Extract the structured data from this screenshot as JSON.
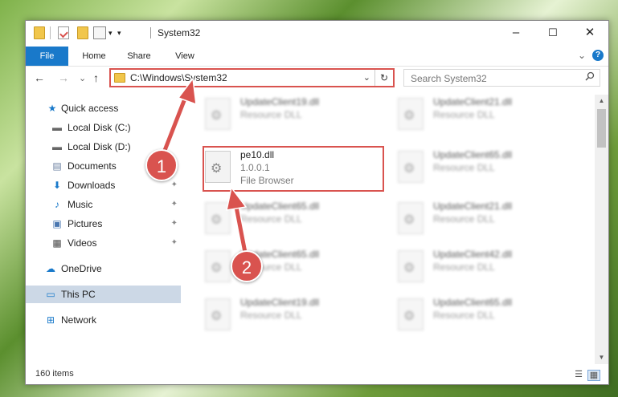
{
  "window": {
    "title": "System32",
    "controls": {
      "minimize": "–",
      "maximize": "☐",
      "close": "✕"
    }
  },
  "ribbon": {
    "tabs": [
      "File",
      "Home",
      "Share",
      "View"
    ],
    "expand_glyph": "⌄",
    "help_glyph": "?"
  },
  "nav": {
    "back": "←",
    "forward": "→",
    "recent": "⌄",
    "up": "↑",
    "address": "C:\\Windows\\System32",
    "address_dropdown": "⌄",
    "refresh": "↻"
  },
  "search": {
    "placeholder": "Search System32",
    "icon": "search-icon"
  },
  "sidebar": {
    "items": [
      {
        "label": "Quick access",
        "icon": "star-icon",
        "glyph": "★",
        "pinned": false
      },
      {
        "label": "Local Disk (C:)",
        "icon": "drive-icon",
        "glyph": "▬",
        "pinned": false
      },
      {
        "label": "Local Disk (D:)",
        "icon": "drive-icon",
        "glyph": "▬",
        "pinned": false
      },
      {
        "label": "Documents",
        "icon": "documents-icon",
        "glyph": "▤",
        "pinned": true
      },
      {
        "label": "Downloads",
        "icon": "download-icon",
        "glyph": "⬇",
        "pinned": true
      },
      {
        "label": "Music",
        "icon": "music-icon",
        "glyph": "♪",
        "pinned": true
      },
      {
        "label": "Pictures",
        "icon": "pictures-icon",
        "glyph": "▣",
        "pinned": true
      },
      {
        "label": "Videos",
        "icon": "videos-icon",
        "glyph": "▦",
        "pinned": true
      },
      {
        "label": "OneDrive",
        "icon": "cloud-icon",
        "glyph": "☁",
        "pinned": false
      },
      {
        "label": "This PC",
        "icon": "computer-icon",
        "glyph": "▭",
        "pinned": false
      },
      {
        "label": "Network",
        "icon": "network-icon",
        "glyph": "⊞",
        "pinned": false
      }
    ],
    "pin_glyph": "📌"
  },
  "files": {
    "left_column": [
      {
        "name": "UpdateClient19.dll",
        "sub1": "Resource DLL",
        "sub2": ""
      },
      {
        "name": "pe10.dll",
        "sub1": "1.0.0.1",
        "sub2": "File Browser"
      },
      {
        "name": "UpdateClient65.dll",
        "sub1": "Resource DLL",
        "sub2": ""
      },
      {
        "name": "UpdateClient65.dll",
        "sub1": "Resource DLL",
        "sub2": ""
      },
      {
        "name": "UpdateClient19.dll",
        "sub1": "Resource DLL",
        "sub2": ""
      }
    ],
    "right_column": [
      {
        "name": "UpdateClient21.dll",
        "sub1": "Resource DLL",
        "sub2": ""
      },
      {
        "name": "UpdateClient65.dll",
        "sub1": "Resource DLL",
        "sub2": ""
      },
      {
        "name": "UpdateClient21.dll",
        "sub1": "Resource DLL",
        "sub2": ""
      },
      {
        "name": "UpdateClient42.dll",
        "sub1": "Resource DLL",
        "sub2": ""
      },
      {
        "name": "UpdateClient65.dll",
        "sub1": "Resource DLL",
        "sub2": ""
      }
    ]
  },
  "status": {
    "count": "160 items"
  },
  "annotations": {
    "step1": "1",
    "step2": "2",
    "color": "#d9534f"
  }
}
